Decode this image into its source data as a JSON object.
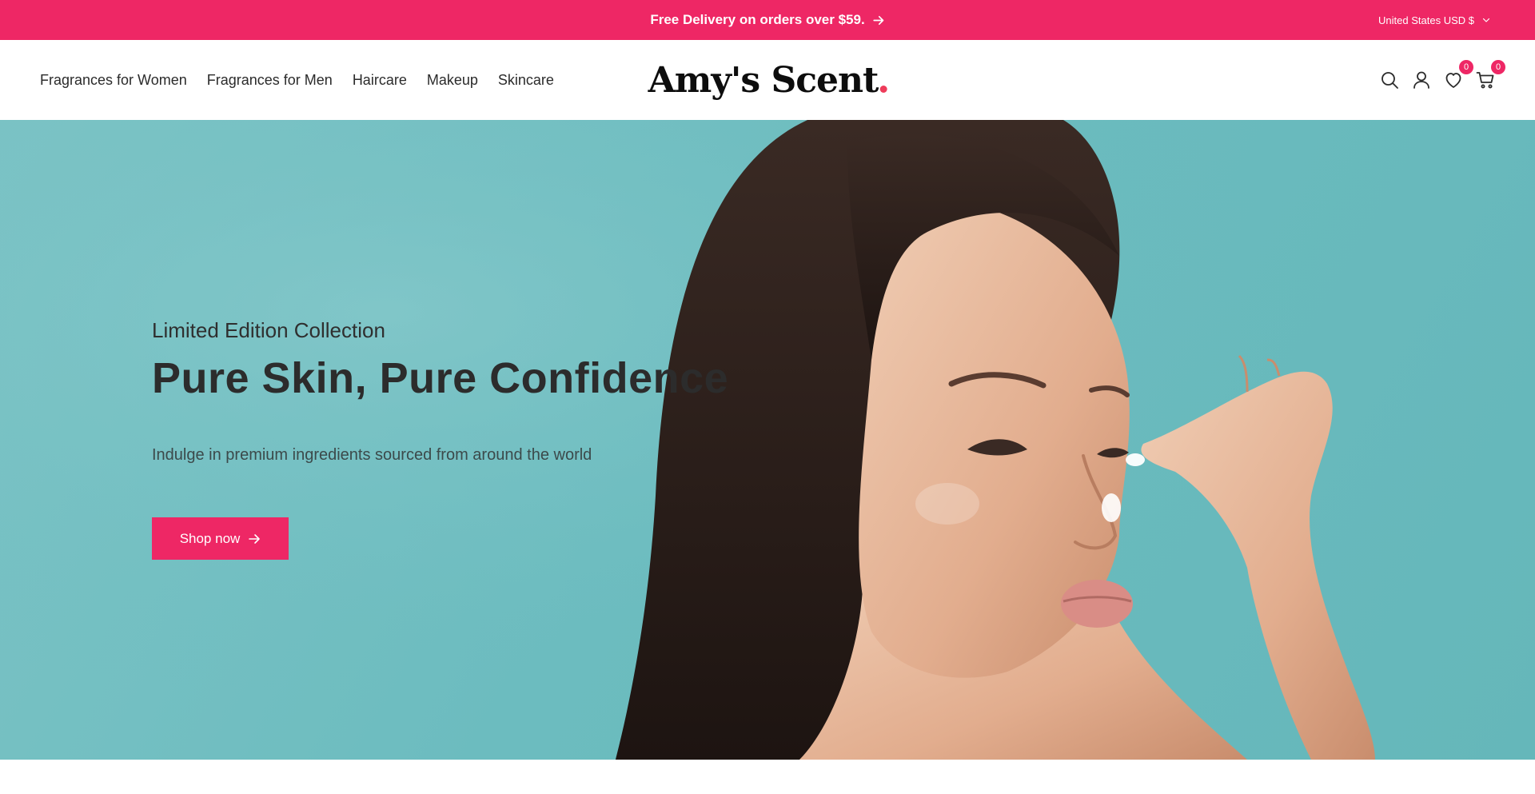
{
  "announcement": {
    "text": "Free Delivery on orders over $59.",
    "arrow_icon": "arrow-right-icon"
  },
  "locale": {
    "label": "United States USD $",
    "chevron_icon": "chevron-down-icon"
  },
  "nav": {
    "items": [
      {
        "label": "Fragrances for Women"
      },
      {
        "label": "Fragrances for Men"
      },
      {
        "label": "Haircare"
      },
      {
        "label": "Makeup"
      },
      {
        "label": "Skincare"
      }
    ]
  },
  "logo": {
    "text": "Amy's Scent",
    "dot_color": "#ee3c5a"
  },
  "header_icons": {
    "search": "search-icon",
    "account": "user-icon",
    "wishlist": "heart-icon",
    "wishlist_count": "0",
    "cart": "cart-icon",
    "cart_count": "0"
  },
  "hero": {
    "subtitle": "Limited Edition Collection",
    "title": "Pure Skin, Pure Confidence",
    "description": "Indulge in premium ingredients sourced from around the world",
    "button_label": "Shop now",
    "button_icon": "arrow-right-icon",
    "background_color": "#6cbcbf"
  },
  "colors": {
    "accent": "#ee2765",
    "text": "#2b2b2b"
  }
}
